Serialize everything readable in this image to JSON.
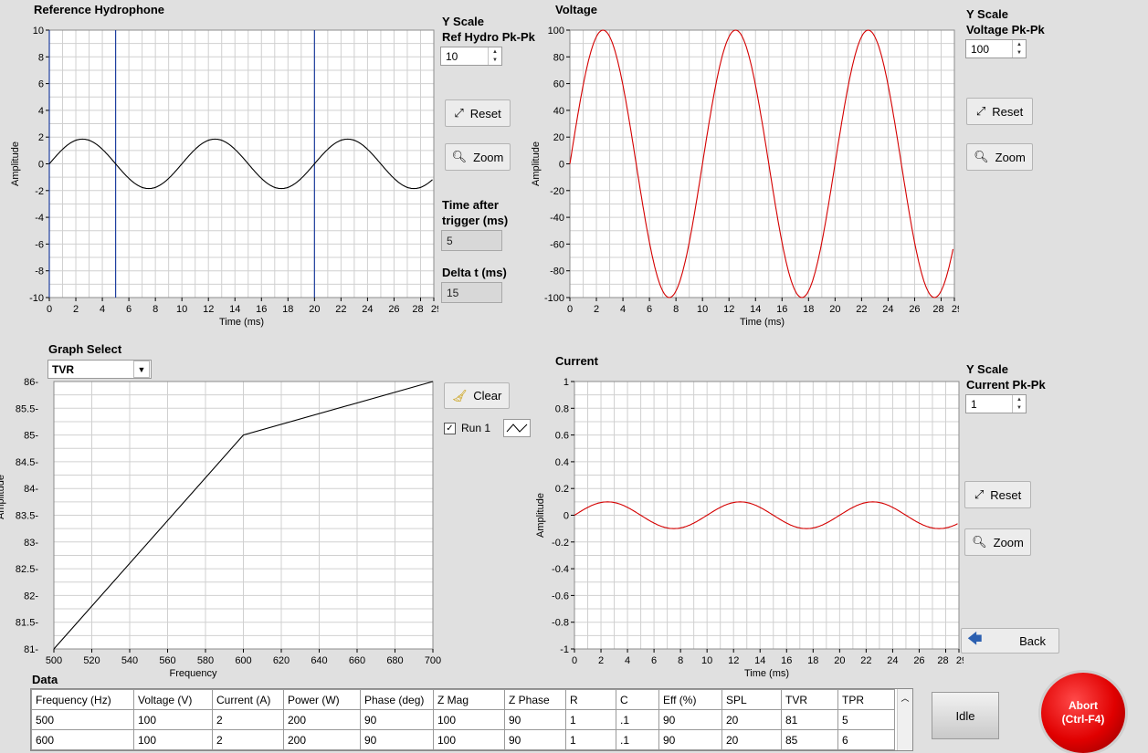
{
  "ref_graph": {
    "title": "Reference Hydrophone",
    "ylabel": "Amplitude",
    "xlabel": "Time (ms)",
    "yticks": [
      "10",
      "8",
      "6",
      "4",
      "2",
      "0",
      "-2",
      "-4",
      "-6",
      "-8",
      "-10"
    ],
    "xticks": [
      "0",
      "2",
      "4",
      "6",
      "8",
      "10",
      "12",
      "14",
      "16",
      "18",
      "20",
      "22",
      "24",
      "26",
      "28",
      "29"
    ],
    "yscale_label_1": "Y Scale",
    "yscale_label_2": "Ref Hydro Pk-Pk",
    "yscale_value": "10",
    "reset_label": "Reset",
    "zoom_label": "Zoom",
    "time_after_label_1": "Time after",
    "time_after_label_2": "trigger (ms)",
    "time_after_value": "5",
    "delta_t_label": "Delta t (ms)",
    "delta_t_value": "15"
  },
  "voltage_graph": {
    "title": "Voltage",
    "ylabel": "Amplitude",
    "xlabel": "Time (ms)",
    "yticks": [
      "100",
      "80",
      "60",
      "40",
      "20",
      "0",
      "-20",
      "-40",
      "-60",
      "-80",
      "-100"
    ],
    "xticks": [
      "0",
      "2",
      "4",
      "6",
      "8",
      "10",
      "12",
      "14",
      "16",
      "18",
      "20",
      "22",
      "24",
      "26",
      "28",
      "29"
    ],
    "yscale_label_1": "Y Scale",
    "yscale_label_2": "Voltage Pk-Pk",
    "yscale_value": "100",
    "reset_label": "Reset",
    "zoom_label": "Zoom"
  },
  "select_graph": {
    "label": "Graph Select",
    "selected": "TVR",
    "ylabel": "Amplitude",
    "xlabel": "Frequency",
    "yticks": [
      "86-",
      "85.5-",
      "85-",
      "84.5-",
      "84-",
      "83.5-",
      "83-",
      "82.5-",
      "82-",
      "81.5-",
      "81-"
    ],
    "xticks": [
      "500",
      "520",
      "540",
      "560",
      "580",
      "600",
      "620",
      "640",
      "660",
      "680",
      "700"
    ],
    "clear_label": "Clear",
    "run_label": "Run 1",
    "run_checked": true
  },
  "current_graph": {
    "title": "Current",
    "ylabel": "Amplitude",
    "xlabel": "Time (ms)",
    "yticks": [
      "1",
      "0.8",
      "0.6",
      "0.4",
      "0.2",
      "0",
      "-0.2",
      "-0.4",
      "-0.6",
      "-0.8",
      "-1"
    ],
    "xticks": [
      "0",
      "2",
      "4",
      "6",
      "8",
      "10",
      "12",
      "14",
      "16",
      "18",
      "20",
      "22",
      "24",
      "26",
      "28",
      "29"
    ],
    "yscale_label_1": "Y Scale",
    "yscale_label_2": "Current Pk-Pk",
    "yscale_value": "1",
    "reset_label": "Reset",
    "zoom_label": "Zoom"
  },
  "back_label": "Back",
  "data_title": "Data",
  "table": {
    "headers": [
      "Frequency (Hz)",
      "Voltage (V)",
      "Current (A)",
      "Power (W)",
      "Phase (deg)",
      "Z Mag",
      "Z Phase",
      "R",
      "C",
      "Eff (%)",
      "SPL",
      "TVR",
      "TPR"
    ],
    "rows": [
      [
        "500",
        "100",
        "2",
        "200",
        "90",
        "100",
        "90",
        "1",
        ".1",
        "90",
        "20",
        "81",
        "5"
      ],
      [
        "600",
        "100",
        "2",
        "200",
        "90",
        "100",
        "90",
        "1",
        ".1",
        "90",
        "20",
        "85",
        "6"
      ]
    ]
  },
  "idle_label": "Idle",
  "abort_label_1": "Abort",
  "abort_label_2": "(Ctrl-F4)",
  "colors": {
    "red_trace": "#d40000",
    "cursor_blue": "#1f3f9f",
    "abort_red": "#e00000"
  },
  "chart_data": [
    {
      "type": "line",
      "title": "Reference Hydrophone",
      "xlabel": "Time (ms)",
      "ylabel": "Amplitude",
      "xlim": [
        0,
        29
      ],
      "ylim": [
        -10,
        10
      ],
      "series": [
        {
          "amplitude": 1.85,
          "period_ms": 10,
          "phase": "sine",
          "color": "#000000"
        }
      ],
      "cursors_x_ms": [
        0,
        5,
        20
      ]
    },
    {
      "type": "line",
      "title": "Voltage",
      "xlabel": "Time (ms)",
      "ylabel": "Amplitude",
      "xlim": [
        0,
        29
      ],
      "ylim": [
        -100,
        100
      ],
      "series": [
        {
          "amplitude": 100,
          "period_ms": 10,
          "phase": "sine",
          "color": "#d40000"
        }
      ]
    },
    {
      "type": "line",
      "title": "Current",
      "xlabel": "Time (ms)",
      "ylabel": "Amplitude",
      "xlim": [
        0,
        29
      ],
      "ylim": [
        -1,
        1
      ],
      "series": [
        {
          "amplitude": 0.1,
          "period_ms": 10,
          "phase": "sine",
          "color": "#d40000"
        }
      ]
    },
    {
      "type": "line",
      "xlabel": "Frequency",
      "ylabel": "Amplitude",
      "xlim": [
        500,
        700
      ],
      "ylim": [
        81,
        86
      ],
      "series": [
        {
          "name": "Run 1",
          "x": [
            500,
            600,
            700
          ],
          "y": [
            81,
            85,
            86
          ],
          "color": "#000000"
        }
      ]
    }
  ]
}
